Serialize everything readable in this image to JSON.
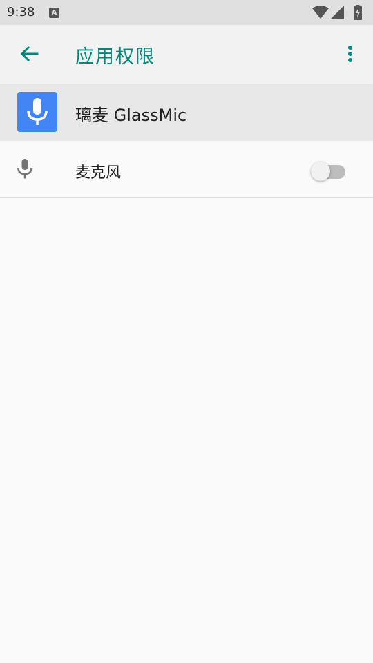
{
  "status_bar": {
    "time": "9:38",
    "notification_icon_letter": "A"
  },
  "app_bar": {
    "title": "应用权限",
    "accent_color": "#00897b"
  },
  "app": {
    "name": "璃麦 GlassMic",
    "icon_color": "#4285f4"
  },
  "permissions": [
    {
      "label": "麦克风",
      "icon": "microphone-icon",
      "enabled": false
    }
  ]
}
